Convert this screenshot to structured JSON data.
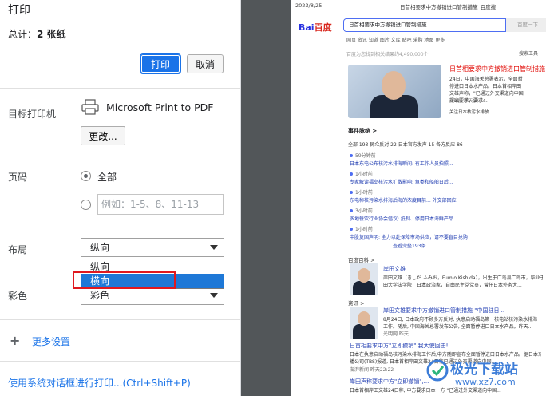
{
  "dialog": {
    "title": "打印",
    "total_prefix": "总计：",
    "total_value": "2 张纸",
    "print_label": "打印",
    "cancel_label": "取消",
    "destination_label": "目标打印机",
    "printer_name": "Microsoft Print to PDF",
    "change_label": "更改...",
    "pages_label": "页码",
    "pages_all": "全部",
    "pages_placeholder": "例如：1-5、8、11-13",
    "layout_label": "布局",
    "layout_value": "纵向",
    "layout_options": [
      "纵向",
      "横向"
    ],
    "color_label": "彩色",
    "color_value": "彩色",
    "more_settings": "更多设置",
    "system_dialog": "使用系统对话框进行打印...(Ctrl+Shift+P)"
  },
  "preview": {
    "date": "2023/8/25",
    "page_title": "日首相要求中方撤销进口管制措施_百度搜",
    "logo_a": "Bai",
    "logo_b": "百度",
    "search_query": "日首相要求中方撤销进口管制措施",
    "search_button": "百度一下",
    "tabs": "网页   资讯   知道   图片   文库   贴吧   采购   地图   更多",
    "tools": "搜索工具",
    "found": "百度为您找到相关结果约4,490,000个",
    "card_title": "日首相要求中方撤销进口管制措施",
    "card_body": "24日，中国海关总署表示，全面暂停进口日本水产品。日本首相岸田文雄声称，\"已通过外交渠道向中国提出要求，要求...",
    "card_source": "环球网  昨天19:34",
    "card_follow": "关注日本核污水排放",
    "events_heading": "事件脉络 >",
    "events_tabs": "全部 193     民众反对 22     日本官方发声 15     各方反应 86",
    "timeline": [
      {
        "time": "59分钟前",
        "text": "日本东电公布核污水排海瞬间: 有工作人员拍照..."
      },
      {
        "time": "1小时前",
        "text": "专家解读福岛核污水扩散影响: 鱼类和船舶日后..."
      },
      {
        "time": "1小时前",
        "text": "东电称核污染水排海后海的浓度目前... 外交部回应"
      },
      {
        "time": "3小时前",
        "text": "多地餐饮行业协会倡议: 抵制、停用日本海鲜产品"
      },
      {
        "time": "1小时前",
        "text": "中股复国声明: 全力以赴保障市场供应，请不要盲目抢购"
      }
    ],
    "events_more": "查看完整193条",
    "baike_heading": "百度百科 >",
    "baike_title": "岸田文雄",
    "baike_lines": [
      "岸田文雄（きしだ ふみお，Fumio Kishida），出生于广岛县广岛市，毕业于早稻",
      "田大学法学院，日本政治家，自由民主党党员，曾任日本外务大..."
    ],
    "news_heading": "资讯 >",
    "news_title": "岸田文雄要求中方撤销进口管制措施 \"中国驻日...",
    "news_lines": [
      "8月24日, 日本政府不顾多方反对, 执意启动福岛第一核电站核污染水排海",
      "工作。随后, 中国海关总署发布公告, 全面暂停进口日本水产品。昨天..."
    ],
    "news_source": "光明网  昨天 ...",
    "r2_title": "日首相要求中方\"立即撤销\",我大使回击!",
    "r2_lines": [
      "日本在执意启动福岛核污染水排海工作后,中方随即宣布全面暂停进口日本水产品。据日本东京广",
      "播公司(TBS)报道, 日本首相岸田文雄24日称已通过外交渠道向中国..."
    ],
    "r2_source": "澎湃新闻  昨天22:22",
    "r3_title": "岸田声称要求中方\"立即撤销\",...",
    "r3_lines": [
      "日本首相岸田文雄24日称, 中方要求日本一方 \"已通过外交渠道向中国..."
    ]
  },
  "watermark": {
    "brand": "极光下载站",
    "url": "www.xz7.com"
  }
}
